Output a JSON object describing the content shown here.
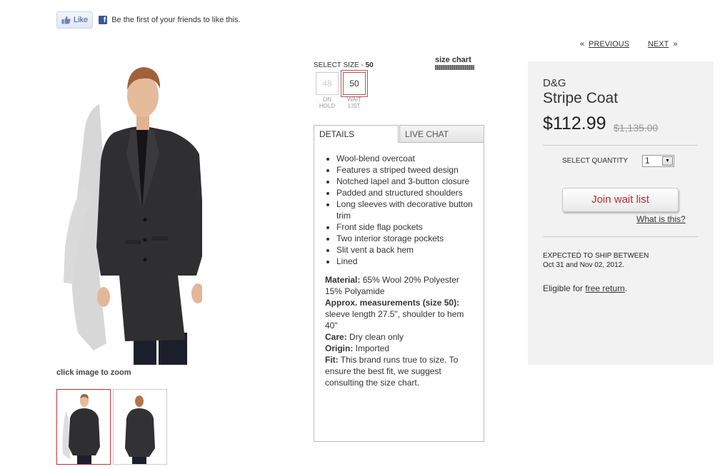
{
  "facebook": {
    "like_label": "Like",
    "friends_text": "Be the first of your friends to like this."
  },
  "pager": {
    "prev_arrows": "«",
    "prev_label": "PREVIOUS",
    "next_label": "NEXT",
    "next_arrows": "»"
  },
  "gallery": {
    "zoom_hint": "click image to zoom"
  },
  "size": {
    "label_prefix": "SELECT SIZE - ",
    "selected": "50",
    "size_chart_label": "size chart",
    "options": [
      {
        "value": "48",
        "note_line1": "ON",
        "note_line2": "HOLD",
        "state": "disabled"
      },
      {
        "value": "50",
        "note_line1": "WAIT",
        "note_line2": "LIST",
        "state": "selected"
      }
    ]
  },
  "tabs": {
    "details": "DETAILS",
    "live_chat": "LIVE CHAT"
  },
  "details": {
    "bullets": [
      "Wool-blend overcoat",
      "Features a striped tweed design",
      "Notched lapel and 3-button closure",
      "Padded and structured shoulders",
      "Long sleeves with decorative button trim",
      "Front side flap pockets",
      "Two interior storage pockets",
      "Slit vent a back hem",
      "Lined"
    ],
    "material_label": "Material:",
    "material_value": " 65% Wool 20% Polyester 15% Polyamide",
    "measure_label": "Approx. measurements (size 50):",
    "measure_value": " sleeve length 27.5\", shoulder to hem 40\"",
    "care_label": "Care:",
    "care_value": " Dry clean only",
    "origin_label": "Origin:",
    "origin_value": " Imported",
    "fit_label": "Fit:",
    "fit_value": " This brand runs true to size. To ensure the best fit, we suggest consulting the size chart."
  },
  "product": {
    "brand": "D&G",
    "name": "Stripe Coat",
    "price": "$112.99",
    "old_price": "$1,135.00",
    "qty_label": "SELECT QUANTITY",
    "qty_value": "1",
    "wait_button": "Join wait list",
    "what_link": "What is this?",
    "ship_line1": "EXPECTED TO SHIP BETWEEN",
    "ship_line2": "Oct 31 and Nov 02, 2012.",
    "eligible_prefix": "Eligible for ",
    "eligible_link": "free return",
    "eligible_suffix": "."
  },
  "colors": {
    "accent_red": "#c0282d",
    "facebook_blue": "#3b5998",
    "buybox_bg": "#f2f2f2"
  }
}
